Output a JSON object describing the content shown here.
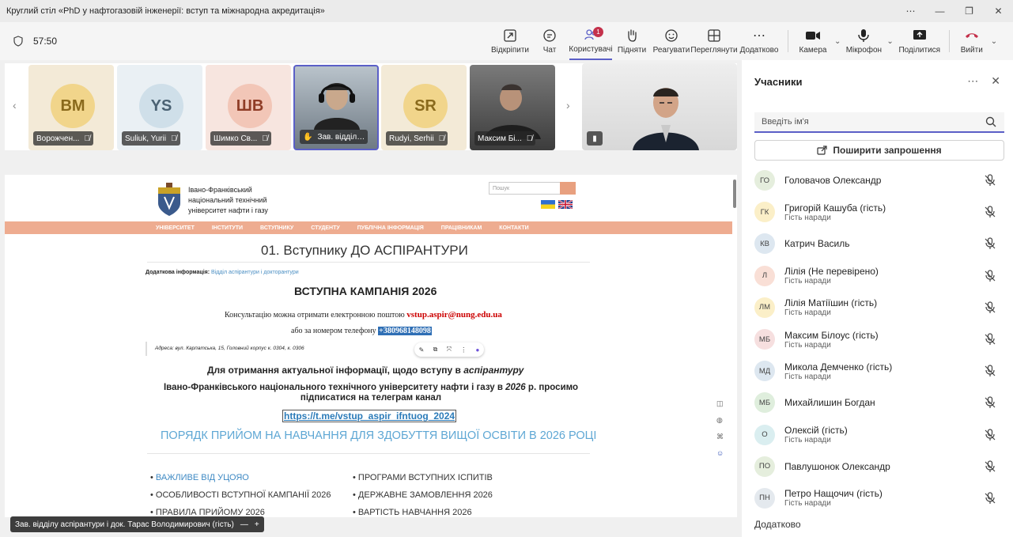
{
  "window": {
    "title": "Круглий стіл «PhD у нафтогазовій інженерії: вступ та міжнародна акредитація»"
  },
  "toolbar": {
    "timer": "57:50",
    "buttons": [
      {
        "label": "Відкріпити",
        "icon": "unpin-icon"
      },
      {
        "label": "Чат",
        "icon": "chat-icon"
      },
      {
        "label": "Користувачі",
        "icon": "people-icon",
        "badge": "1"
      },
      {
        "label": "Підняти",
        "icon": "raise-hand-icon"
      },
      {
        "label": "Реагувати",
        "icon": "react-icon"
      },
      {
        "label": "Переглянути",
        "icon": "view-icon"
      },
      {
        "label": "Додатково",
        "icon": "more-icon"
      }
    ],
    "camera": "Камера",
    "mic": "Мікрофон",
    "share": "Поділитися",
    "leave": "Вийти"
  },
  "strip": {
    "tiles": [
      {
        "initials": "ВМ",
        "name": "Ворожчен...",
        "bg": "#f3ead7",
        "avatar_bg": "#f1d58b",
        "avatar_fg": "#8a6a1c"
      },
      {
        "initials": "YS",
        "name": "Suliuk, Yurii",
        "bg": "#eaf0f4",
        "avatar_bg": "#cfdfe9",
        "avatar_fg": "#4b6273"
      },
      {
        "initials": "ШВ",
        "name": "Шимко Св...",
        "bg": "#f7e5df",
        "avatar_bg": "#f2c6b7",
        "avatar_fg": "#8f3c26"
      },
      {
        "initials": "",
        "name": "Зав. відділу а...",
        "video": true,
        "hand": true
      },
      {
        "initials": "SR",
        "name": "Rudyi, Serhii",
        "bg": "#f3ead7",
        "avatar_bg": "#f1d58b",
        "avatar_fg": "#8a6a1c"
      },
      {
        "initials": "",
        "name": "Максим Бі...",
        "video": true
      }
    ]
  },
  "shared": {
    "uni_name": "Івано-Франківський національний технічний університет нафти і газу",
    "search_placeholder": "Пошук",
    "menu": [
      "УНІВЕРСИТЕТ",
      "ІНСТИТУТИ",
      "ВСТУПНИКУ",
      "СТУДЕНТУ",
      "ПУБЛІЧНА ІНФОРМАЦІЯ",
      "ПРАЦІВНИКАМ",
      "КОНТАКТИ"
    ],
    "h1": "01. Вступнику ДО АСПІРАНТУРИ",
    "addl_label": "Додаткова інформація:",
    "addl_link": "Відділ аспірантури і докторантури",
    "campaign": "ВСТУПНА КАМПАНІЯ 2026",
    "consult_text": "Консультацію можна отримати електронною поштою",
    "email": "vstup.aspir@nung.edu.ua",
    "phone_text": "або за номером телефону",
    "phone": "+380968148098",
    "address": "Адреса: вул. Карпатська, 15, Головний корпус к. 0304, к. 0306",
    "actual_a": "Для отримання актуальної інформації, щодо вступу в",
    "actual_b": "аспірантуру",
    "uni_line_a": "Івано-Франківського національного технічного університету нафти і газу в",
    "uni_line_year": "2026",
    "uni_line_b": "р.  просимо підписатися на телеграм канал",
    "telegram": "https://t.me/vstup_aspir_ifntuog_2024",
    "order": "ПОРЯДК ПРИЙОМ НА НАВЧАННЯ ДЛЯ ЗДОБУТТЯ ВИЩОЇ ОСВІТИ В 2026 РОЦІ",
    "list_left": [
      "ВАЖЛИВЕ ВІД УЦОЯО",
      "ОСОБЛИВОСТІ ВСТУПНОЇ КАМПАНІЇ 2026",
      "ПРАВИЛА ПРИЙОМУ 2026"
    ],
    "list_right": [
      "ПРОГРАМИ ВСТУПНИХ ІСПИТІВ",
      "ДЕРЖАВНЕ ЗАМОВЛЕННЯ 2026",
      "ВАРТІСТЬ НАВЧАННЯ 2026"
    ]
  },
  "presenter_tag": "Зав. відділу аспірантури і док. Тарас Володимирович (гість)",
  "panel": {
    "title": "Учасники",
    "search_placeholder": "Введіть ім'я",
    "invite": "Поширити запрошення",
    "people": [
      {
        "initials": "ГО",
        "name": "Головачов Олександр",
        "sub": "",
        "color": "#e5eedd"
      },
      {
        "initials": "ГК",
        "name": "Григорій Кашуба (гість)",
        "sub": "Гість наради",
        "color": "#fbefc8"
      },
      {
        "initials": "КВ",
        "name": "Катрич Василь",
        "sub": "",
        "color": "#dde7f0"
      },
      {
        "initials": "Л",
        "name": "Лілія (Не перевірено)",
        "sub": "Гість наради",
        "color": "#f9dfd6"
      },
      {
        "initials": "ЛМ",
        "name": "Лілія Матіїшин (гість)",
        "sub": "Гість наради",
        "color": "#fbefc8"
      },
      {
        "initials": "МБ",
        "name": "Максим Білоус (гість)",
        "sub": "Гість наради",
        "color": "#f6dfdf"
      },
      {
        "initials": "МД",
        "name": "Микола Демченко (гість)",
        "sub": "Гість наради",
        "color": "#dde7f0"
      },
      {
        "initials": "МБ",
        "name": "Михайлишин Богдан",
        "sub": "",
        "color": "#dfeedd"
      },
      {
        "initials": "О",
        "name": "Олексій (гість)",
        "sub": "Гість наради",
        "color": "#daeef0"
      },
      {
        "initials": "ПО",
        "name": "Павлушонок Олександр",
        "sub": "",
        "color": "#e5eedd"
      },
      {
        "initials": "ПН",
        "name": "Петро Нащочич (гість)",
        "sub": "Гість наради",
        "color": "#e4e9ee"
      }
    ],
    "more": "Додатково"
  }
}
